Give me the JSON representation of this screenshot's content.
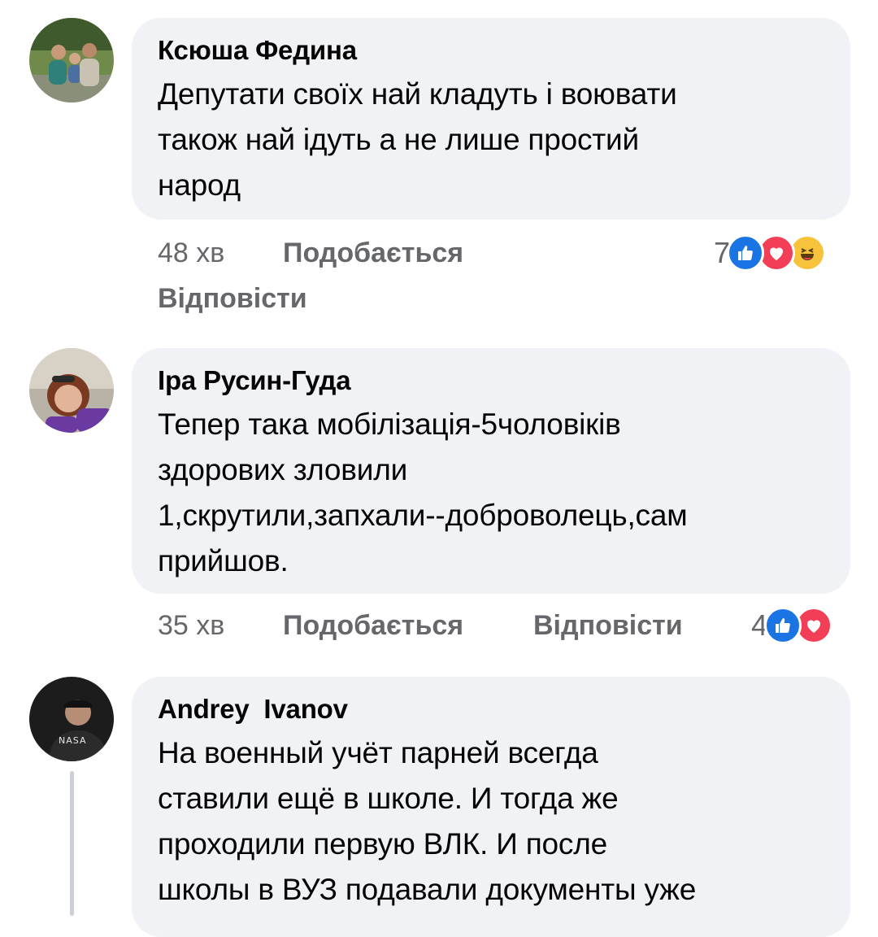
{
  "comments": [
    {
      "author": "Ксюша Федина",
      "text_lines": [
        "Депутати своїх най кладуть і воювати",
        "також най ідуть а не лише простий",
        "народ"
      ],
      "time": "48 хв",
      "like_label": "Подобається",
      "reply_label": "Відповісти",
      "reaction_count": "7",
      "reactions": [
        "like-icon",
        "love-icon",
        "haha-icon"
      ]
    },
    {
      "author": "Іра Русин-Гуда",
      "text_lines": [
        "Тепер така мобілізація-5чоловіків",
        "здорових зловили",
        "1,скрутили,запхали--доброволець,сам",
        "прийшов."
      ],
      "time": "35 хв",
      "like_label": "Подобається",
      "reply_label": "Відповісти",
      "reaction_count": "4",
      "reactions": [
        "like-icon",
        "love-icon"
      ]
    },
    {
      "author": "Andrey  Ivanov",
      "text_lines": [
        "На военный учёт парней всегда",
        "ставили ещё в школе. И тогда же",
        "проходили первую ВЛК. И после",
        "школы в ВУЗ подавали документы уже"
      ],
      "avatar_text": "NASA"
    }
  ],
  "colors": {
    "bubble": "#f0f2f5",
    "meta": "#65676b",
    "like": "#1b74e4",
    "love": "#f33e58",
    "haha": "#f7c23c"
  }
}
